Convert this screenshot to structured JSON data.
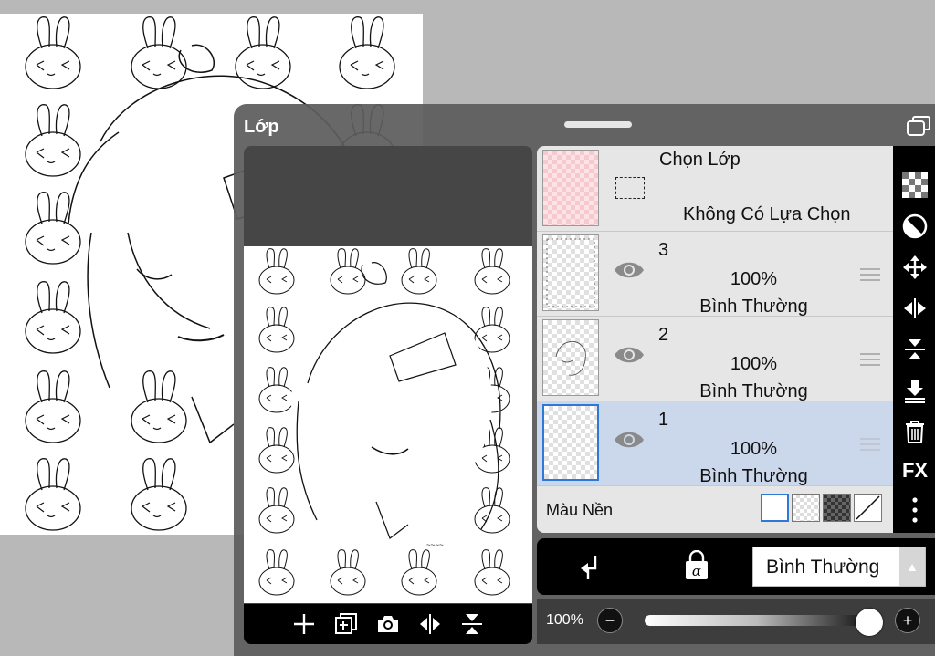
{
  "panel": {
    "title": "Lớp"
  },
  "selection_layer": {
    "name": "Chọn Lớp",
    "status": "Không Có Lựa Chọn"
  },
  "layers": [
    {
      "name": "3",
      "opacity": "100%",
      "blend": "Bình Thường",
      "selected": false
    },
    {
      "name": "2",
      "opacity": "100%",
      "blend": "Bình Thường",
      "selected": false
    },
    {
      "name": "1",
      "opacity": "100%",
      "blend": "Bình Thường",
      "selected": true
    }
  ],
  "background": {
    "label": "Màu Nền"
  },
  "blend_mode": {
    "value": "Bình Thường"
  },
  "opacity": {
    "label": "100%",
    "value": 1.0
  },
  "side_toolbar": {
    "fx_label": "FX"
  },
  "colors": {
    "selected_row": "#cbd7ea",
    "selected_border": "#2f78d6",
    "panel_bg": "#5c5c5c"
  }
}
